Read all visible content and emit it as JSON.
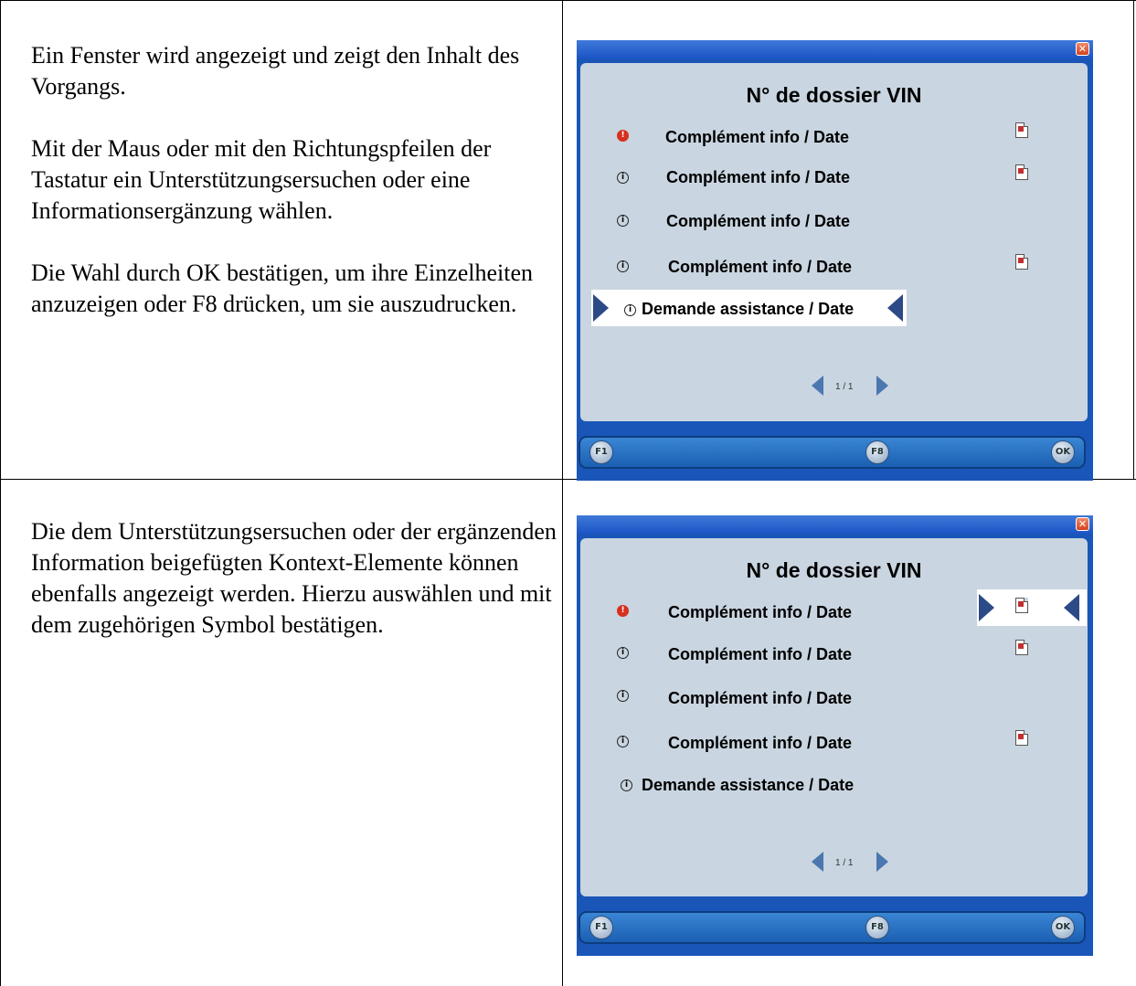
{
  "rows": [
    {
      "description": [
        "Ein Fenster wird angezeigt und zeigt den Inhalt des Vorgangs.",
        "Mit der Maus oder mit den Richtungspfeilen der Tastatur ein Unterstützungsersuchen oder eine Informationsergänzung wählen.",
        "Die Wahl durch OK bestätigen, um ihre Einzelheiten anzuzeigen oder F8 drücken, um sie auszudrucken."
      ]
    },
    {
      "description": [
        "Die dem Unterstützungsersuchen oder der ergänzenden Information beigefügten Kontext-Elemente können ebenfalls angezeigt werden. Hierzu auswählen und mit dem zugehörigen Symbol bestätigen."
      ]
    }
  ],
  "screen": {
    "title": "N° de dossier   VIN",
    "close_glyph": "✕",
    "items": [
      {
        "label": "Complément info  /  Date",
        "icon": "alert-icon",
        "attachment": true
      },
      {
        "label": "Complément info  /  Date",
        "icon": "info-icon",
        "attachment": true
      },
      {
        "label": "Complément info  /  Date",
        "icon": "info-icon",
        "attachment": false
      },
      {
        "label": "Complément info  /  Date",
        "icon": "info-icon",
        "attachment": true
      },
      {
        "label": "Demande assistance  /  Date",
        "icon": "info-icon",
        "attachment": false
      }
    ],
    "pagination": "1 / 1",
    "footer_buttons": {
      "back": "F1",
      "print": "F8",
      "ok": "OK"
    }
  },
  "colors": {
    "accent": "#1a56b8",
    "panel": "#c9d5e0",
    "selection_arrow": "#2c4a86",
    "alert": "#d63020"
  }
}
